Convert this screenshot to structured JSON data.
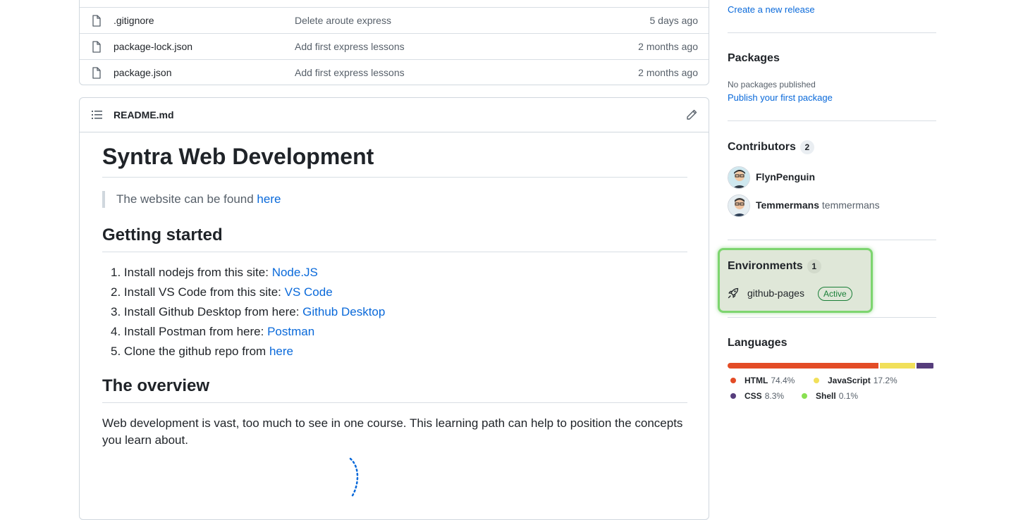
{
  "files": [
    {
      "name": ".gitignore",
      "message": "Delete aroute express",
      "age": "5 days ago"
    },
    {
      "name": "package-lock.json",
      "message": "Add first express lessons",
      "age": "2 months ago"
    },
    {
      "name": "package.json",
      "message": "Add first express lessons",
      "age": "2 months ago"
    }
  ],
  "readme": {
    "file_label": "README.md",
    "title": "Syntra Web Development",
    "quote_text": "The website can be found ",
    "quote_link": "here",
    "h2_getting_started": "Getting started",
    "steps": [
      {
        "num": "1.",
        "text": "Install nodejs from this site: ",
        "link": "Node.JS"
      },
      {
        "num": "2.",
        "text": "Install VS Code from this site: ",
        "link": "VS Code"
      },
      {
        "num": "3.",
        "text": "Install Github Desktop from here: ",
        "link": "Github Desktop"
      },
      {
        "num": "4.",
        "text": "Install Postman from here: ",
        "link": "Postman"
      },
      {
        "num": "5.",
        "text": "Clone the github repo from ",
        "link": "here"
      }
    ],
    "h2_overview": "The overview",
    "overview_text": "Web development is vast, too much to see in one course. This learning path can help to position the concepts you learn about."
  },
  "sidebar": {
    "releases_link": "Create a new release",
    "packages": {
      "heading": "Packages",
      "none": "No packages published",
      "link": "Publish your first package"
    },
    "contributors": {
      "heading": "Contributors",
      "count": "2",
      "people": [
        {
          "name": "FlynPenguin",
          "login": ""
        },
        {
          "name": "Temmermans",
          "login": "temmermans"
        }
      ]
    },
    "environments": {
      "heading": "Environments",
      "count": "1",
      "name": "github-pages",
      "status": "Active"
    },
    "languages": {
      "heading": "Languages",
      "items": [
        {
          "name": "HTML",
          "percent": "74.4%",
          "value": 74.4,
          "color": "#e34c26"
        },
        {
          "name": "JavaScript",
          "percent": "17.2%",
          "value": 17.2,
          "color": "#f1e05a"
        },
        {
          "name": "CSS",
          "percent": "8.3%",
          "value": 8.3,
          "color": "#563d7c"
        },
        {
          "name": "Shell",
          "percent": "0.1%",
          "value": 0.1,
          "color": "#89e051"
        }
      ]
    }
  }
}
